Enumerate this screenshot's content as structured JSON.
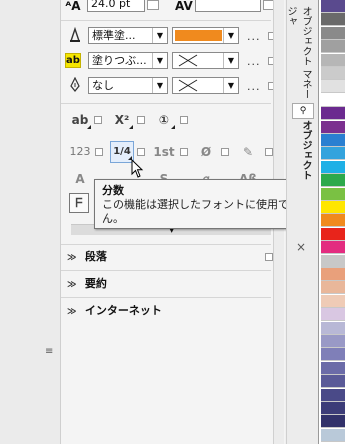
{
  "font_size": {
    "value": "24.0 pt"
  },
  "fill": {
    "outline_pen": "標準塗...",
    "outline_color": "#f08a1e",
    "background": "塗りつぶ...",
    "underline": "なし"
  },
  "more_dots": "...",
  "tools": {
    "row1": [
      "ab",
      "X²",
      "①"
    ],
    "row2": [
      "123",
      "1/4",
      "1st",
      "Ø",
      "✎"
    ],
    "row3": [
      "A",
      "S",
      "ℊ",
      "&8",
      "Aß"
    ]
  },
  "tooltip": {
    "title": "分数",
    "description": "この機能は選択したフォントに使用できません。"
  },
  "sections": [
    {
      "label": "段落"
    },
    {
      "label": "要約"
    },
    {
      "label": "インターネット"
    }
  ],
  "tabs": {
    "top": "オブジェクト マネージャ",
    "bottom": "オブジェクト"
  },
  "palette": [
    "#5a4a8e",
    "#6a6a6a",
    "#8a8a8a",
    "#a0a0a0",
    "#b6b6b6",
    "#cbcbcb",
    "#e1e1e1",
    "#ffffff",
    "#6b2a8f",
    "#7b2f8f",
    "#2a7fd1",
    "#34a3dd",
    "#1eb0e6",
    "#2da94b",
    "#7ac143",
    "#ffe600",
    "#f08a1e",
    "#e8241b",
    "#e32c80",
    "#c8c8c8",
    "#e9a07b",
    "#e9b79a",
    "#efcbb6",
    "#d9c7e2",
    "#b8b8d6",
    "#9999c6",
    "#7f7fb8",
    "#6b6ba8",
    "#5a5a98",
    "#4a4a88",
    "#3c3c78",
    "#31316a",
    "#b9c9d9"
  ],
  "close_label": "×"
}
